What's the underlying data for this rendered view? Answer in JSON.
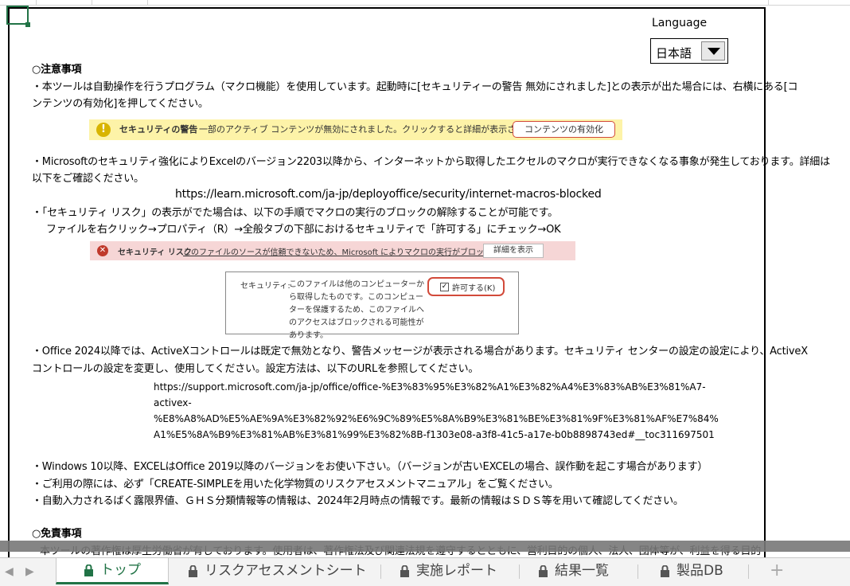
{
  "language": {
    "label": "Language",
    "selected": "日本語"
  },
  "notes": {
    "heading": "○注意事項",
    "macro_line1": "・本ツールは自動操作を行うプログラム（マクロ機能）を使用しています。起動時に[セキュリティーの警告 無効にされました]との表示が出た場合には、右横にある[コ",
    "macro_line2": "ンテンツの有効化]を押してください。",
    "banner": {
      "title": "セキュリティの警告",
      "message": "一部のアクティブ コンテンツが無効にされました。クリックすると詳細が表示されます。",
      "button": "コンテンツの有効化"
    },
    "ms_line1": "・Microsoftのセキュリティ強化によりExcelのバージョン2203以降から、インターネットから取得したエクセルのマクロが実行できなくなる事象が発生しております。詳細は",
    "ms_line2": "以下をご確認ください。",
    "ms_url": "https://learn.microsoft.com/ja-jp/deployoffice/security/internet-macros-blocked",
    "risk_line1": "・「セキュリティ リスク」の表示がでた場合は、以下の手順でマクロの実行のブロックの解除することが可能です。",
    "risk_line2": "ファイルを右クリック→プロパティ（R）→全般タブの下部におけるセキュリティで「許可する」にチェック→OK",
    "risk_bar": {
      "title": "セキュリティ リスク",
      "message": "このファイルのソースが信頼できないため、Microsoft によりマクロの実行がブロックされました。",
      "button": "詳細を表示"
    },
    "security_box": {
      "label": "セキュリティ:",
      "description": "このファイルは他のコンピューターから取得したものです。このコンピューターを保護するため、このファイルへのアクセスはブロックされる可能性があります。",
      "allow": "許可する(K)"
    },
    "office_line1": "・Office 2024以降では、ActiveXコントロールは既定で無効となり、警告メッセージが表示される場合があります。セキュリティ センターの設定の設定により、ActiveX",
    "office_line2": "コントロールの設定を変更し、使用してください。設定方法は、以下のURLを参照してください。",
    "office_url_1": "https://support.microsoft.com/ja-jp/office/office-%E3%83%95%E3%82%A1%E3%82%A4%E3%83%AB%E3%81%A7-",
    "office_url_2": "activex-",
    "office_url_3": "%E8%A8%AD%E5%AE%9A%E3%82%92%E6%9C%89%E5%8A%B9%E3%81%BE%E3%81%9F%E3%81%AF%E7%84%",
    "office_url_4": "A1%E5%8A%B9%E3%81%AB%E3%81%99%E3%82%8B-f1303e08-a3f8-41c5-a17e-b0b8898743ed#__toc311697501",
    "windows_line": "・Windows 10以降、EXCELはOffice 2019以降のバージョンをお使い下さい。（バージョンが古いEXCELの場合、誤作動を起こす場合があります）",
    "manual_line": "・ご利用の際には、必ず「CREATE-SIMPLEを用いた化学物質のリスクアセスメントマニュアル」をご覧ください。",
    "auto_line": "・自動入力されるばく露限界値、ＧＨＳ分類情報等の情報は、2024年2月時点の情報です。最新の情報はＳＤＳ等を用いて確認してください。"
  },
  "disclaimer": {
    "heading": "○免責事項",
    "line1": "本ツールの著作権は厚生労働省が有しております。使用者は、著作権法及び関連法規を遵守するとともに、営利目的の個人、法人、団体等が、利益を得る目的"
  },
  "tabs": [
    {
      "label": "トップ",
      "active": true
    },
    {
      "label": "リスクアセスメントシート",
      "active": false
    },
    {
      "label": "実施レポート",
      "active": false
    },
    {
      "label": "結果一覧",
      "active": false
    },
    {
      "label": "製品DB",
      "active": false
    }
  ],
  "add_sheet": "+",
  "accent_color": "#217346"
}
